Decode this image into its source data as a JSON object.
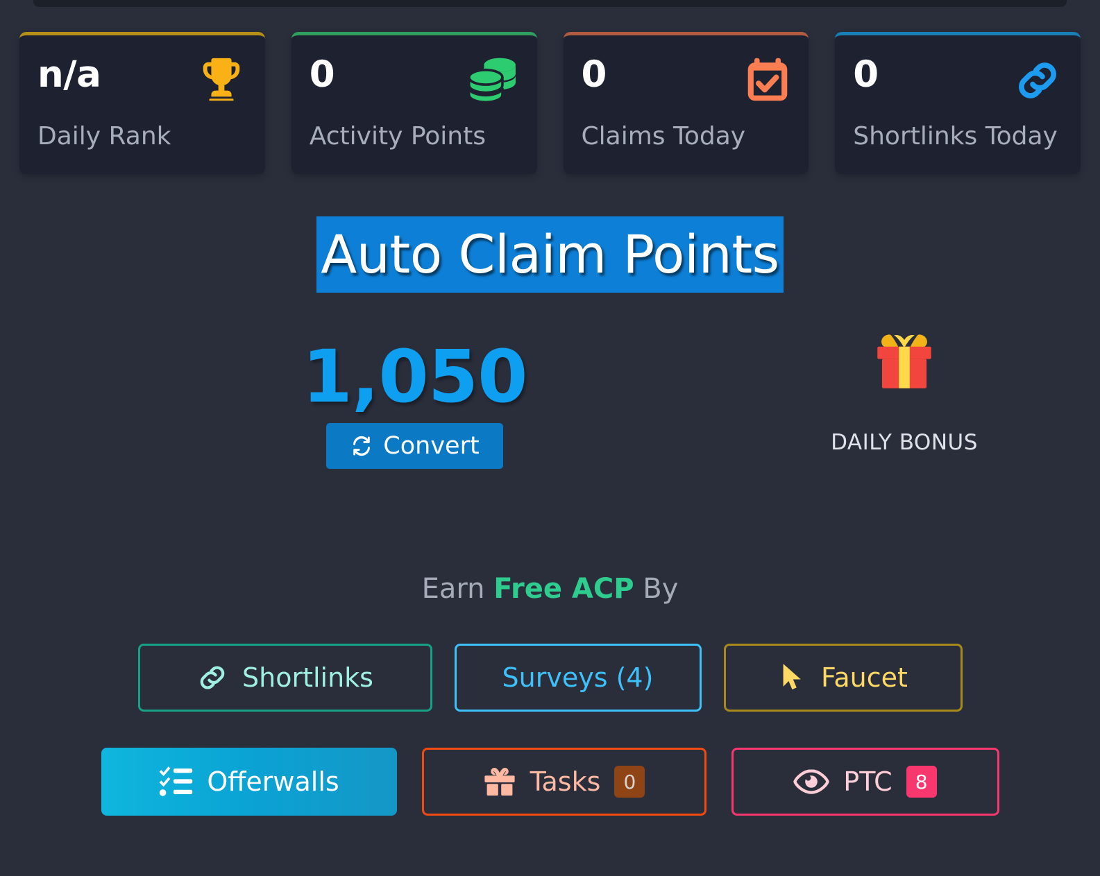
{
  "stats": [
    {
      "value": "n/a",
      "label": "Daily Rank",
      "accent": "#b7901a",
      "icon": "trophy-icon"
    },
    {
      "value": "0",
      "label": "Activity Points",
      "accent": "#2f9e5e",
      "icon": "coins-icon"
    },
    {
      "value": "0",
      "label": "Claims Today",
      "accent": "#b05a42",
      "icon": "calendar-check-icon"
    },
    {
      "value": "0",
      "label": "Shortlinks Today",
      "accent": "#1a7fb5",
      "icon": "link-icon"
    }
  ],
  "main": {
    "title": "Auto Claim Points",
    "balance": "1,050",
    "convert_label": "Convert",
    "convert_icon": "sync-icon"
  },
  "daily_bonus": {
    "label": "DAILY BONUS",
    "icon": "gift-icon"
  },
  "earn": {
    "prefix": "Earn ",
    "highlight": "Free ACP",
    "suffix": " By",
    "buttons_row1": [
      {
        "label": "Shortlinks",
        "icon": "link-icon",
        "badge": null
      },
      {
        "label": "Surveys (4)",
        "icon": null,
        "badge": null
      },
      {
        "label": "Faucet",
        "icon": "cursor-icon",
        "badge": null
      }
    ],
    "buttons_row2": [
      {
        "label": "Offerwalls",
        "icon": "tasklist-icon",
        "badge": null
      },
      {
        "label": "Tasks",
        "icon": "gift-icon",
        "badge": "0"
      },
      {
        "label": "PTC",
        "icon": "eye-icon",
        "badge": "8"
      }
    ]
  },
  "colors": {
    "page_bg": "#2a2e3b",
    "card_bg": "#1e2230",
    "title_highlight": "#0d7fd6",
    "balance_blue": "#0f9ff0",
    "acp_green": "#2ecc8f"
  }
}
